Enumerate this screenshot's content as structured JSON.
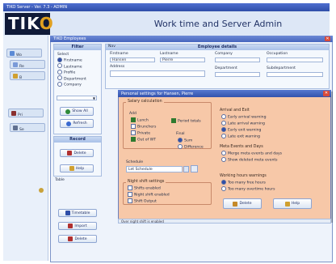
{
  "window": {
    "title": "TIKO Server - Ver. 7.3 - ADMIN"
  },
  "banner": {
    "logo_text": "TIK",
    "logo_o": "O",
    "title": "Work time and Server Admin"
  },
  "main": {
    "title": "TIKO Employees"
  },
  "filter": {
    "header": "Filter",
    "select_label": "Select",
    "options": [
      {
        "label": "Firstname",
        "checked": true
      },
      {
        "label": "Lastname",
        "checked": false
      },
      {
        "label": "Profile",
        "checked": false
      },
      {
        "label": "Department",
        "checked": false
      },
      {
        "label": "Company",
        "checked": false
      }
    ],
    "search_button": "Show All",
    "refresh_button": "Refresh"
  },
  "record": {
    "header": "Record",
    "delete_button": "Delete",
    "help_button": "Help"
  },
  "table_label": "Table",
  "bottom_buttons": {
    "timetable": "Timetable",
    "import": "Import",
    "delete": "Delete"
  },
  "employee": {
    "header": "Employee details",
    "nav_label": "Nav",
    "firstname_label": "Firstname",
    "firstname_value": "Hansen",
    "lastname_label": "Lastname",
    "lastname_value": "Pierre",
    "company_label": "Company",
    "occupation_label": "Occupation",
    "address_label": "Address",
    "department_label": "Department",
    "subdepartment_label": "Subdepartment"
  },
  "dialog": {
    "title": "Personal settings for Hansen, Pierre",
    "salary_group": "Salary calculation",
    "add_label": "Add",
    "add_options": [
      {
        "label": "Lunch",
        "checked": true
      },
      {
        "label": "Brunchers",
        "checked": false
      },
      {
        "label": "Private",
        "checked": false
      },
      {
        "label": "Out of WT",
        "checked": true
      }
    ],
    "period_totals": {
      "label": "Period totals",
      "checked": true
    },
    "final_label": "Final",
    "final_options": [
      {
        "label": "Sum",
        "checked": true
      },
      {
        "label": "Difference",
        "checked": false
      }
    ],
    "schedule_label": "Schedule",
    "schedule_value": "Let Schedule",
    "night_group": "Night shift settings",
    "night_options": [
      {
        "label": "Shifts enabled",
        "checked": false
      },
      {
        "label": "Night shift enabled",
        "checked": false
      },
      {
        "label": "Shift Output",
        "checked": false
      }
    ],
    "arrival_group": "Arrival and Exit",
    "arrival_options": [
      {
        "label": "Early arrival warning",
        "checked": false
      },
      {
        "label": "Late arrival warning",
        "checked": false
      },
      {
        "label": "Early exit warning",
        "checked": true
      },
      {
        "label": "Late exit warning",
        "checked": false
      }
    ],
    "meta_group": "Meta Events and Days",
    "meta_options": [
      {
        "label": "Merge meta events and days",
        "checked": false
      },
      {
        "label": "Show deleted meta events",
        "checked": false
      }
    ],
    "hours_group": "Working hours warnings",
    "hours_options": [
      {
        "label": "Too many free hours",
        "checked": true
      },
      {
        "label": "Too many overtime hours",
        "checked": false
      }
    ],
    "delete_button": "Delete",
    "help_button": "Help"
  },
  "statusbar": "Over night shift is enabled",
  "sidebar": [
    {
      "label": "Wo"
    },
    {
      "label": "Re"
    },
    {
      "label": "B"
    },
    {
      "label": "Pri"
    },
    {
      "label": "Se"
    }
  ],
  "colors": {
    "accent": "#3353ad",
    "dialog_bg": "#f7c8a8",
    "banner_bg": "#dde7f6"
  }
}
